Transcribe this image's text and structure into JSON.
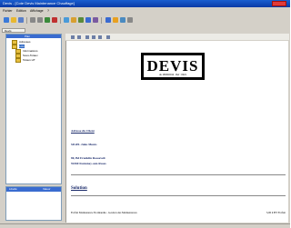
{
  "window": {
    "title": "Devis - [Cote Devis Maintenance Chauffage]"
  },
  "menubar": {
    "items": [
      "Fichier",
      "Edition",
      "Affichage",
      "?"
    ]
  },
  "tab": {
    "label": "Devis"
  },
  "tree": {
    "header": "Plan",
    "items": [
      {
        "label": "Adresses"
      },
      {
        "label": "Lots"
      },
      {
        "label": "Informations"
      },
      {
        "label": "Sous-Totaux"
      },
      {
        "label": "Totaux HT"
      }
    ]
  },
  "bottom_panel": {
    "col1": "Libellé",
    "col2": "Valeur"
  },
  "document": {
    "devis_title": "DEVIS",
    "devis_sub": "du 18/06/2012 - Ref : 0021",
    "address_heading": "Adresse du Client",
    "address_lines": [
      "SIGEL Jules Monts",
      "80, Bd Franklin Roosevelt",
      "92260 Fontenay-aux-Roses"
    ],
    "section": "Solution",
    "line_item": "Forfait Maintenance Normandie - Gestion des Maintenances",
    "line_price": "3,00 € HT Forfait"
  },
  "colors": {
    "titlebar": "#0a3aa6",
    "close": "#e03a3a",
    "selection": "#316ac5"
  }
}
